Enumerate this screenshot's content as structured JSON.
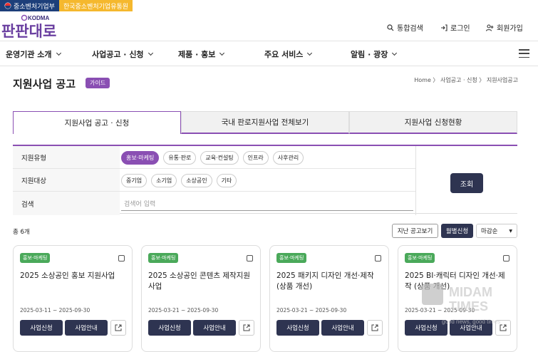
{
  "topbar": {
    "ministry": "중소벤처기업부",
    "agency": "한국중소벤처기업유통원"
  },
  "logo": {
    "brand": "KODMA",
    "name": "판판대로"
  },
  "util": {
    "search": "통합검색",
    "login": "로그인",
    "join": "회원가입"
  },
  "nav": [
    "운영기관 소개",
    "사업공고 · 신청",
    "제품 · 홍보",
    "주요 서비스",
    "알림 · 광장"
  ],
  "page": {
    "title": "지원사업 공고",
    "guide": "가이드",
    "breadcrumb": "Home 〉 사업공고 · 신청 〉 지원사업공고"
  },
  "tabs": [
    "지원사업 공고 · 신청",
    "국내 판로지원사업 전체보기",
    "지원사업 신청현황"
  ],
  "filter": {
    "type_label": "지원유형",
    "type_options": [
      "홍보·마케팅",
      "유통·판로",
      "교육·컨설팅",
      "인프라",
      "사후관리"
    ],
    "target_label": "지원대상",
    "target_options": [
      "중기업",
      "소기업",
      "소상공인",
      "기타"
    ],
    "search_label": "검색",
    "search_placeholder": "검색어 입력",
    "query_button": "조회"
  },
  "list": {
    "count": "총 6개",
    "past_button": "지난 공고보기",
    "status_button": "월별신청",
    "sort": "마감순"
  },
  "cards": [
    {
      "tag": "홍보·마케팅",
      "title": "2025 소상공인 홍보 지원사업",
      "date": "2025-03-11 ~ 2025-09-30",
      "apply": "사업신청",
      "info": "사업안내"
    },
    {
      "tag": "홍보·마케팅",
      "title": "2025 소상공인 콘텐츠 제작지원사업",
      "date": "2025-03-21 ~ 2025-09-30",
      "apply": "사업신청",
      "info": "사업안내"
    },
    {
      "tag": "홍보·마케팅",
      "title": "2025 패키지 디자인 개선·제작 (상품 개선)",
      "date": "2025-03-21 ~ 2025-09-30",
      "apply": "사업신청",
      "info": "사업안내"
    },
    {
      "tag": "홍보·마케팅",
      "title": "2025 BI·캐릭터 디자인 개선·제작 (상품 개선)",
      "date": "2025-03-21 ~ 2025-09-30",
      "apply": "사업신청",
      "info": "사업안내"
    }
  ],
  "watermark": {
    "line1": "MIDAM",
    "line2": "TIMES",
    "slogan": "good news, good times"
  },
  "colors": {
    "accent": "#8a4fb3",
    "dark_button": "#2e3451",
    "tag_green": "#4aa95a",
    "top_navy": "#1d3f7a",
    "top_yellow": "#f5b82e"
  }
}
